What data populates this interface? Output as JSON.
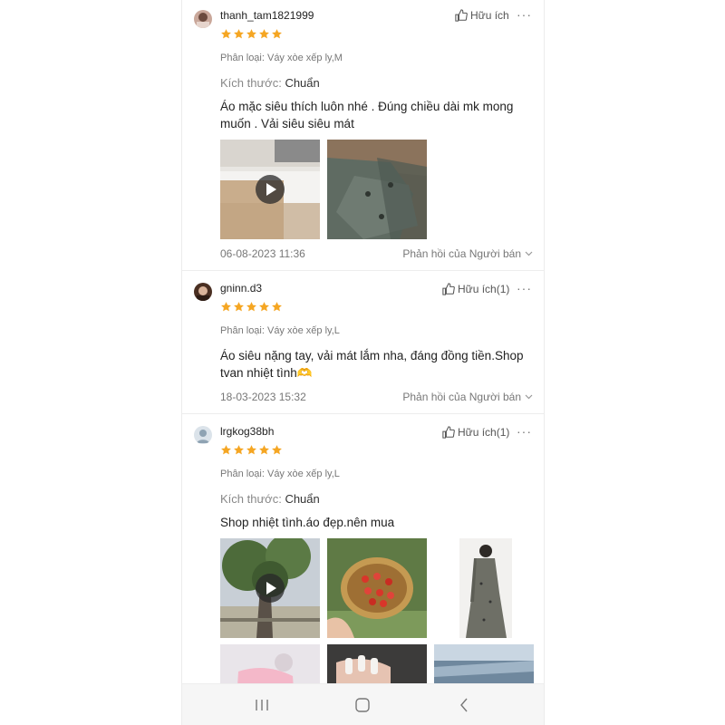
{
  "reviews": [
    {
      "username": "thanh_tam1821999",
      "rating": 5,
      "helpful_label": "Hữu ích",
      "variant": "Phân loại: Váy xòe xếp ly,M",
      "size_label": "Kích thước:",
      "size_value": "Chuẩn",
      "comment_lines": [
        "Áo mặc siêu thích luôn nhé . Đúng chiều dài mk mong",
        "muốn . Vải siêu siêu mát"
      ],
      "date": "06-08-2023 11:36",
      "seller_reply": "Phản hồi của Người bán"
    },
    {
      "username": "gninn.d3",
      "rating": 5,
      "helpful_label": "Hữu ích(1)",
      "variant": "Phân loại: Váy xòe xếp ly,L",
      "comment_lines": [
        "Áo siêu nặng tay, vải mát lắm nha, đáng đồng tiền.Shop",
        "tvan nhiệt tình🫶"
      ],
      "date": "18-03-2023 15:32",
      "seller_reply": "Phản hồi của Người bán"
    },
    {
      "username": "lrgkog38bh",
      "rating": 5,
      "helpful_label": "Hữu ích(1)",
      "variant": "Phân loại: Váy xòe xếp ly,L",
      "size_label": "Kích thước:",
      "size_value": "Chuẩn",
      "comment_lines": [
        "Shop nhiệt tình.áo đẹp.nên mua"
      ]
    }
  ],
  "icons": {
    "star": "star-icon",
    "thumb": "thumb-up-icon",
    "more": "more-dots-icon",
    "chevron": "chevron-down-icon",
    "play": "play-icon"
  },
  "colors": {
    "star": "#f5a623",
    "text_muted": "#777777",
    "divider": "#ededed"
  },
  "navbar": {
    "recent": "recent-apps-icon",
    "home": "home-icon",
    "back": "back-icon"
  }
}
